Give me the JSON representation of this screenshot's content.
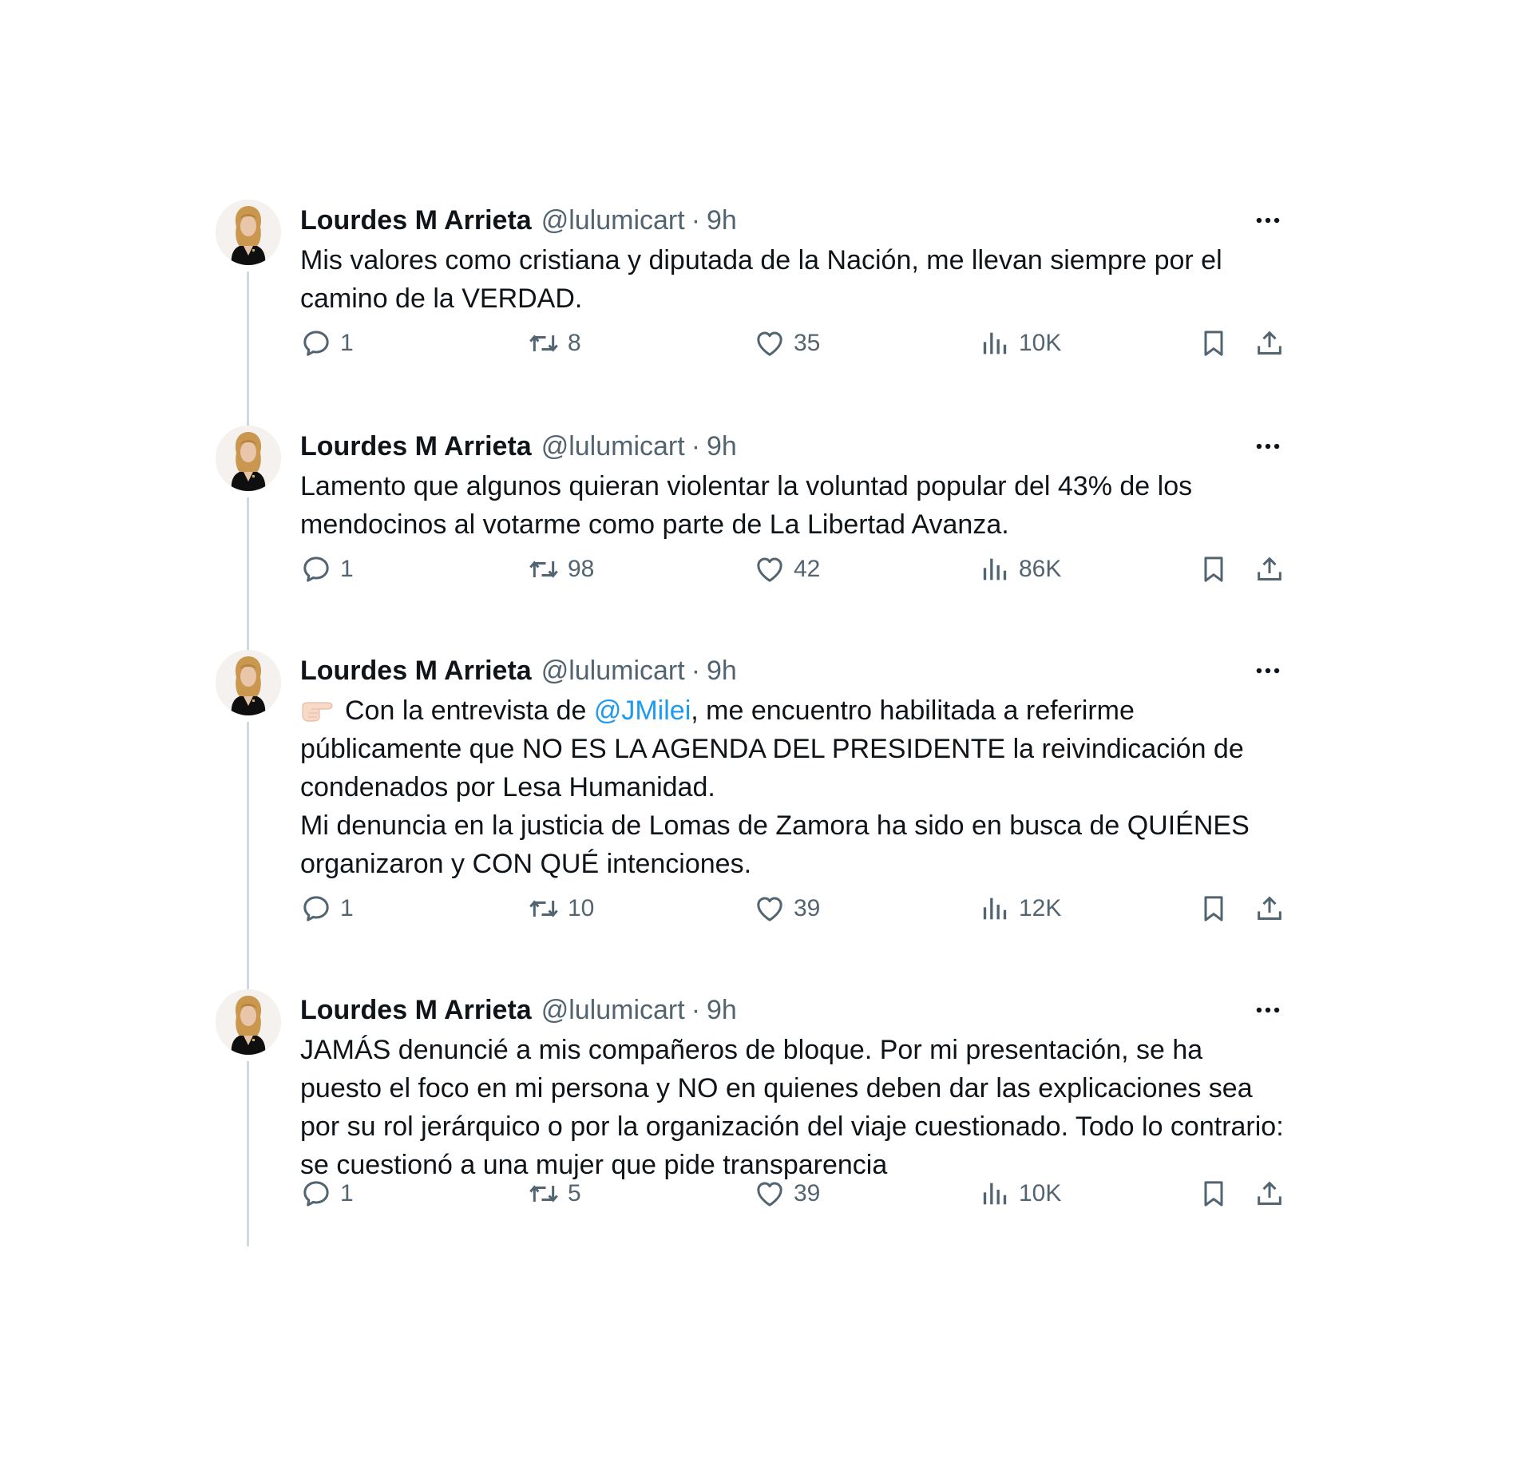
{
  "tweets": [
    {
      "author": {
        "name": "Lourdes M Arrieta",
        "handle": "@lulumicart",
        "separator": "·",
        "time": "9h"
      },
      "text": [
        "Mis valores como cristiana y diputada de la Nación, me llevan siempre por el camino de la VERDAD."
      ],
      "stats": {
        "replies": "1",
        "reposts": "8",
        "likes": "35",
        "views": "10K"
      }
    },
    {
      "author": {
        "name": "Lourdes M Arrieta",
        "handle": "@lulumicart",
        "separator": "·",
        "time": "9h"
      },
      "text": [
        "Lamento que algunos quieran violentar la voluntad popular del 43% de los mendocinos al votarme como parte de La Libertad Avanza."
      ],
      "stats": {
        "replies": "1",
        "reposts": "98",
        "likes": "42",
        "views": "86K"
      }
    },
    {
      "author": {
        "name": "Lourdes M Arrieta",
        "handle": "@lulumicart",
        "separator": "·",
        "time": "9h"
      },
      "text_parts": {
        "emoji": "pointing-right-emoji",
        "before_mention": "Con la entrevista de ",
        "mention": "@JMilei",
        "after_mention": ", me encuentro habilitada a referirme públicamente que NO ES LA AGENDA DEL PRESIDENTE la reivindicación de condenados por Lesa Humanidad.",
        "second_paragraph": "Mi denuncia en la justicia de Lomas de Zamora ha sido en busca de QUIÉNES organizaron y CON QUÉ intenciones."
      },
      "stats": {
        "replies": "1",
        "reposts": "10",
        "likes": "39",
        "views": "12K"
      }
    },
    {
      "author": {
        "name": "Lourdes M Arrieta",
        "handle": "@lulumicart",
        "separator": "·",
        "time": "9h"
      },
      "text": [
        "JAMÁS denuncié a mis compañeros de bloque. Por mi presentación, se ha puesto el foco en mi persona y NO en quienes deben dar las explicaciones sea por su rol jerárquico o por la organización del viaje cuestionado. Todo lo contrario: se cuestionó a una mujer que pide transparencia"
      ],
      "stats": {
        "replies": "1",
        "reposts": "5",
        "likes": "39",
        "views": "10K"
      }
    }
  ],
  "icons": {
    "more": "more-icon",
    "reply": "reply-icon",
    "repost": "repost-icon",
    "like": "heart-icon",
    "views": "views-icon",
    "bookmark": "bookmark-icon",
    "share": "share-icon"
  },
  "colors": {
    "text": "#0f1419",
    "secondary": "#536471",
    "mention": "#1d9bf0",
    "thread_line": "#cfd9de"
  }
}
